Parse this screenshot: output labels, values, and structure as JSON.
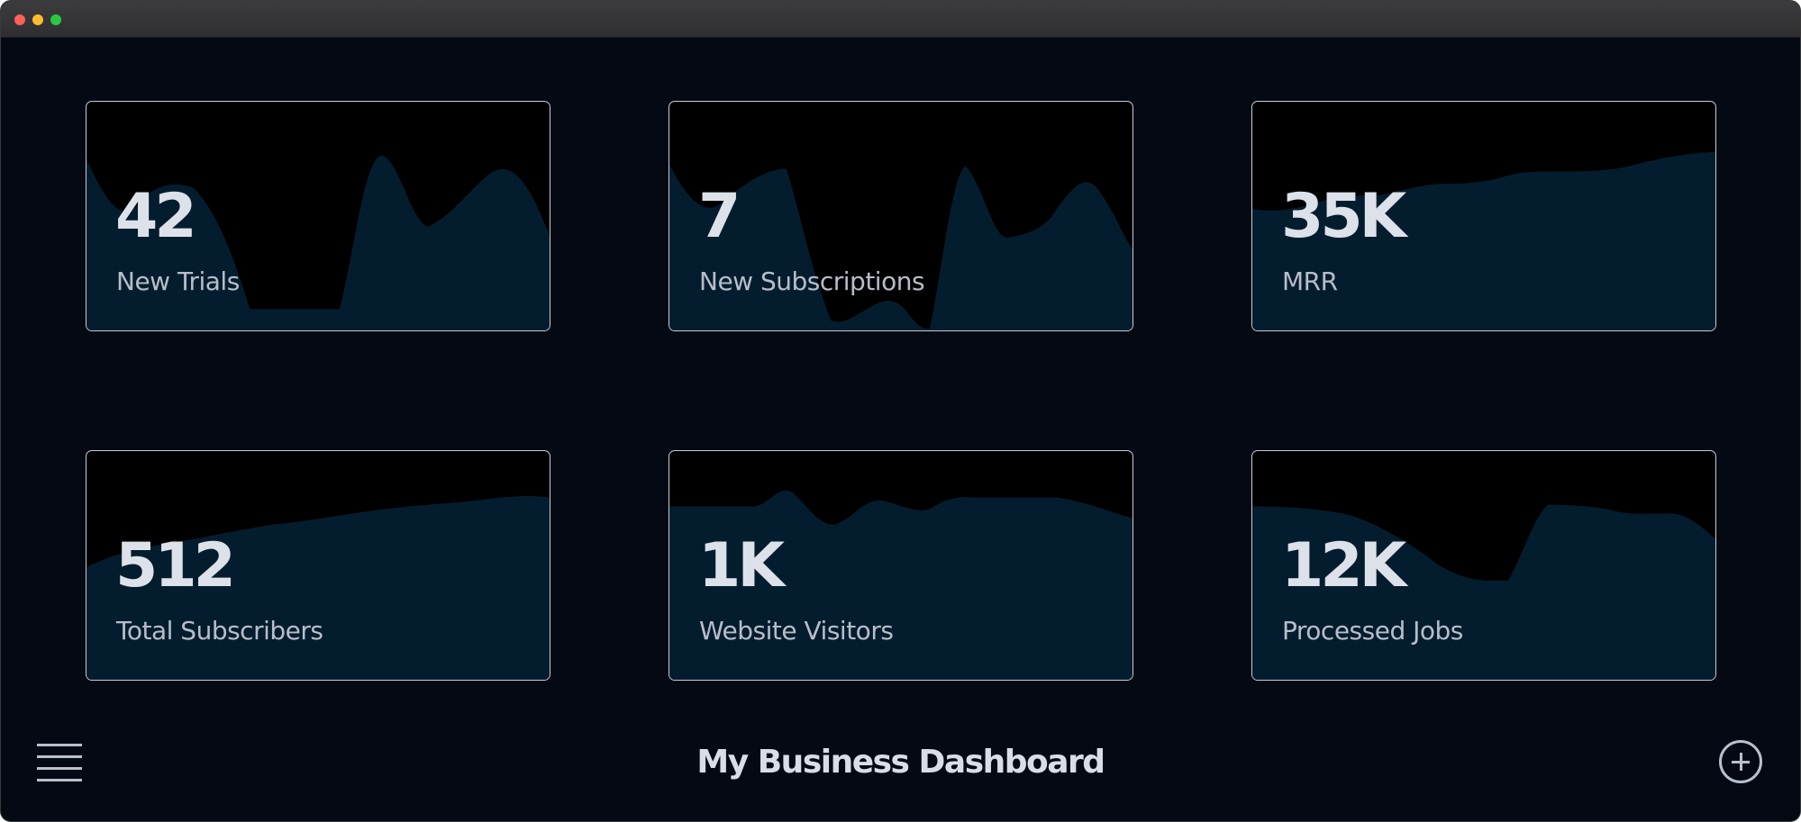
{
  "window": {
    "traffic_lights": [
      "close",
      "minimize",
      "zoom"
    ]
  },
  "colors": {
    "background": "#040914",
    "card_background": "#000000",
    "sparkline_fill": "#041d2e",
    "card_border": "#c7ccd6",
    "value_text": "#dde2ea",
    "label_text": "#b7bec9"
  },
  "cards": [
    {
      "value": "42",
      "label": "New Trials"
    },
    {
      "value": "7",
      "label": "New Subscriptions"
    },
    {
      "value": "35K",
      "label": "MRR"
    },
    {
      "value": "512",
      "label": "Total Subscribers"
    },
    {
      "value": "1K",
      "label": "Website Visitors"
    },
    {
      "value": "12K",
      "label": "Processed Jobs"
    }
  ],
  "footer": {
    "title": "My Business Dashboard",
    "menu_icon": "hamburger-icon",
    "add_icon": "plus-circle-icon"
  }
}
